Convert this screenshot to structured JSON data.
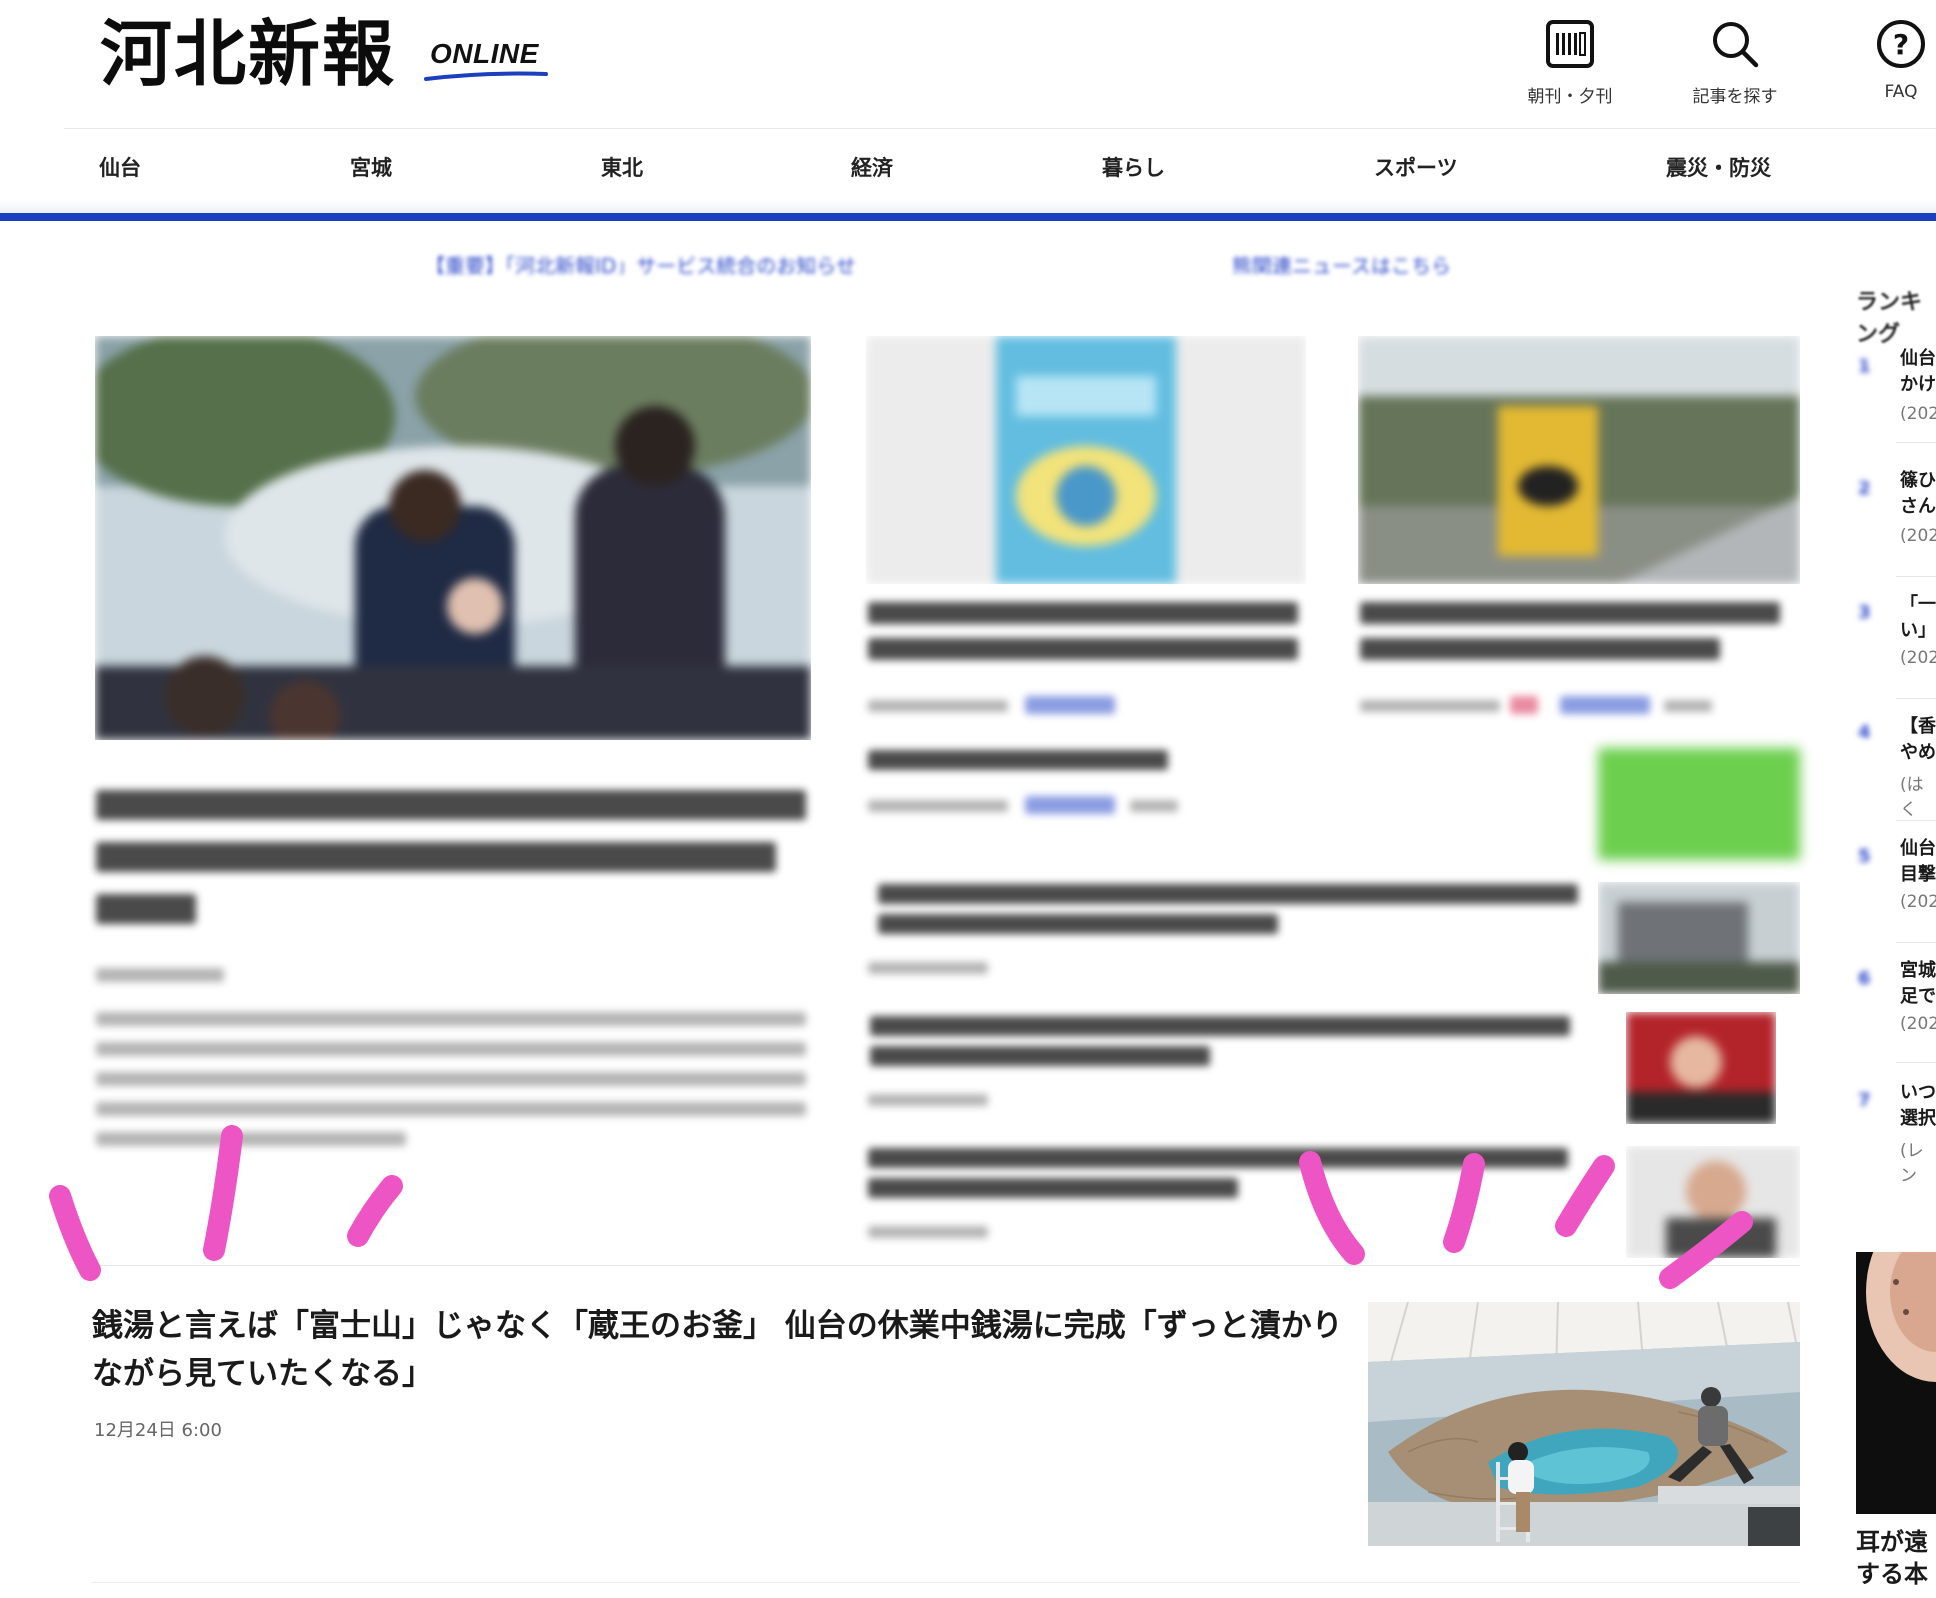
{
  "header": {
    "logo_text": "河北新報",
    "logo_suffix": "ONLINE",
    "tools": [
      {
        "label": "朝刊・夕刊",
        "icon": "newspaper-icon"
      },
      {
        "label": "記事を探す",
        "icon": "search-icon"
      },
      {
        "label": "FAQ",
        "icon": "help-icon"
      }
    ]
  },
  "nav": {
    "items": [
      "仙台",
      "宮城",
      "東北",
      "経済",
      "暮らし",
      "スポーツ",
      "震災・防災"
    ]
  },
  "notices": [
    "【重要】「河北新報ID」サービス統合のお知らせ",
    "熊関連ニュースはこちら"
  ],
  "featured": {
    "title": "銭湯と言えば「富士山」じゃなく「蔵王のお釜」 仙台の休業中銭湯に完成「ずっと漬かりながら見ていたくなる」",
    "date": "12月24日 6:00"
  },
  "ranking": {
    "heading": "ランキング",
    "items": [
      {
        "num": "1",
        "line1": "仙台",
        "line2": "かけ",
        "sub": "(202"
      },
      {
        "num": "2",
        "line1": "篠ひ",
        "line2": "さん",
        "sub": "(202"
      },
      {
        "num": "3",
        "line1": "「一",
        "line2": "い」",
        "sub": "(202"
      },
      {
        "num": "4",
        "line1": "【香",
        "line2": "やめ",
        "sub": "(はく"
      },
      {
        "num": "5",
        "line1": "仙台",
        "line2": "目撃",
        "sub": "(202"
      },
      {
        "num": "6",
        "line1": "宮城",
        "line2": "足で",
        "sub": "(202"
      },
      {
        "num": "7",
        "line1": "いつ",
        "line2": "選択",
        "sub": "(レン"
      }
    ]
  },
  "sidebar_bottom": {
    "line1": "耳が遠",
    "line2": "する本"
  },
  "colors": {
    "accent": "#1d3fbd",
    "link": "#2b48c9",
    "marker": "#ee55c4"
  }
}
